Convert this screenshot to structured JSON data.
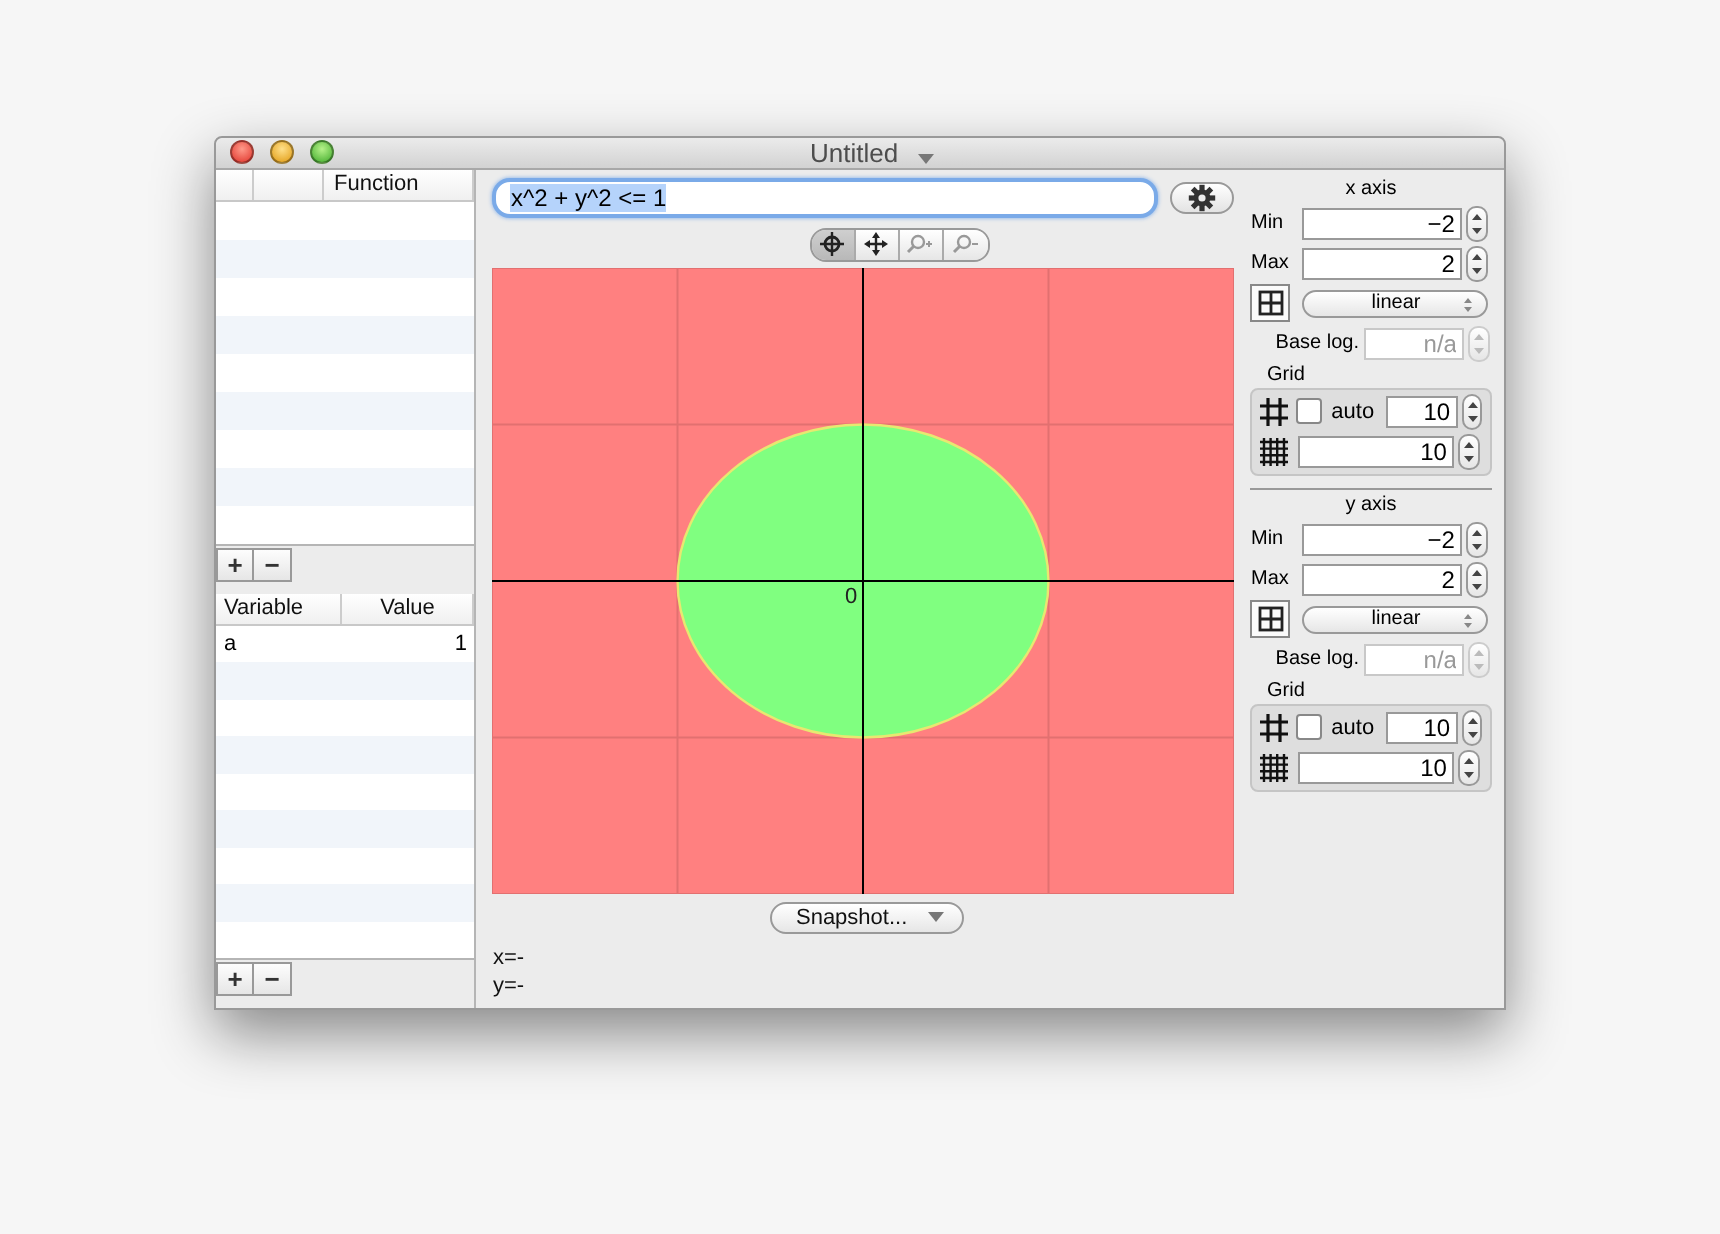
{
  "window": {
    "title": "Untitled"
  },
  "function_table": {
    "header": "Function",
    "add_button": "+",
    "remove_button": "−"
  },
  "variable_table": {
    "columns": [
      "Variable",
      "Value"
    ],
    "rows": [
      {
        "variable": "a",
        "value": "1"
      }
    ],
    "add_button": "+",
    "remove_button": "−"
  },
  "formula": {
    "value": "x^2 + y^2 <= 1",
    "text_selected": true
  },
  "tools": [
    {
      "kind": "crosshair",
      "selected": true
    },
    {
      "kind": "move",
      "selected": false
    },
    {
      "kind": "zoom-in",
      "selected": false
    },
    {
      "kind": "zoom-out",
      "selected": false
    }
  ],
  "plot": {
    "origin_label": "0"
  },
  "snapshot_button": "Snapshot...",
  "cursor": {
    "x": "x=-",
    "y": "y=-"
  },
  "axes": [
    {
      "title": "x axis",
      "min_label": "Min",
      "min": "−2",
      "max_label": "Max",
      "max": "2",
      "scale": "linear",
      "base_log_label": "Base log.",
      "base_log": "n/a",
      "base_log_disabled": true,
      "grid_label": "Grid",
      "auto_label": "auto",
      "auto": false,
      "major": "10",
      "minor": "10"
    },
    {
      "title": "y axis",
      "min_label": "Min",
      "min": "−2",
      "max_label": "Max",
      "max": "2",
      "scale": "linear",
      "base_log_label": "Base log.",
      "base_log": "n/a",
      "base_log_disabled": true,
      "grid_label": "Grid",
      "auto_label": "auto",
      "auto": false,
      "major": "10",
      "minor": "10"
    }
  ]
}
